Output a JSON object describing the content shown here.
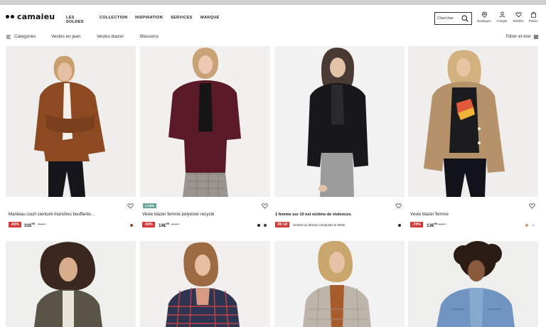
{
  "brand": {
    "name": "camaieu"
  },
  "mainnav": [
    "LES SOLDES",
    "COLLECTION",
    "INSPIRATION",
    "SERVICES",
    "MARQUE"
  ],
  "search": {
    "placeholder": "Chercher"
  },
  "utilities": [
    {
      "label": "Boutiques",
      "icon": "store-pin-icon"
    },
    {
      "label": "Compte",
      "icon": "user-icon"
    },
    {
      "label": "Wishlist",
      "icon": "heart-icon"
    },
    {
      "label": "Panier",
      "icon": "bag-icon"
    }
  ],
  "subnav": {
    "categories": "Categories",
    "links": [
      "Vestes en jean",
      "Vestes blazer",
      "Blousons"
    ],
    "filter": "Filtrer et trier"
  },
  "colors": {
    "sale_red": "#d23b38",
    "care_tag": "#6aa39b",
    "photo_bg": "#efefee"
  },
  "products": [
    {
      "title": "Manteau court ceinturé manches bouffante...",
      "discount": "-60%",
      "price": "31€",
      "price_cents": "99",
      "old_price": "79€⁹⁹",
      "swatches": [
        "#8a4a24"
      ]
    },
    {
      "tag": "CARE",
      "title": "Veste blazer femme polyester recyclé",
      "discount": "-50%",
      "price": "14€",
      "price_cents": "99",
      "old_price": "29€⁹⁹",
      "swatches": [
        "#222222",
        "#3b3b3b"
      ]
    },
    {
      "warning_title": "1 femme sur 10 est victime de violences.",
      "phone": "39 19",
      "warning_sub": "victime ou témoin composez le 3919.",
      "swatches": [
        "#222222"
      ]
    },
    {
      "title": "Veste blazer femme",
      "discount": "-70%",
      "price": "13€",
      "price_cents": "99",
      "old_price": "45€⁹⁹",
      "swatches": [
        "#c9a07a",
        "#d9d9d9"
      ]
    }
  ]
}
